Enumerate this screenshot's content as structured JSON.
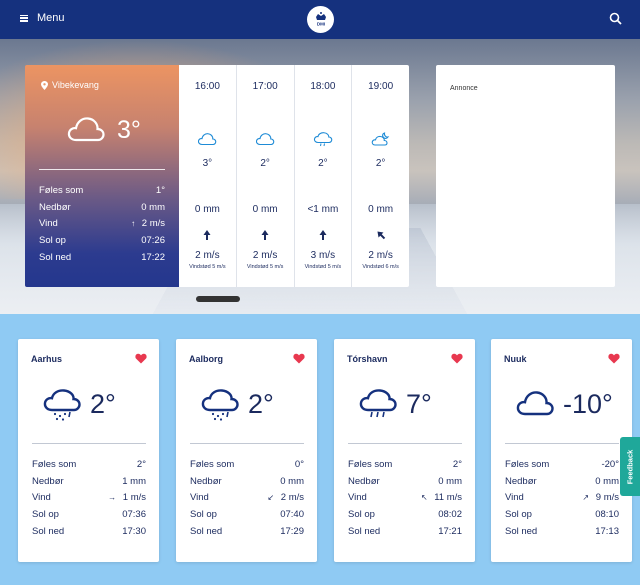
{
  "header": {
    "menu_label": "Menu",
    "logo_text": "DMI"
  },
  "current": {
    "location": "Vibekevang",
    "temp": "3°",
    "stats": [
      {
        "label": "Føles som",
        "value": "1°",
        "arrow": ""
      },
      {
        "label": "Nedbør",
        "value": "0 mm",
        "arrow": ""
      },
      {
        "label": "Vind",
        "value": "2 m/s",
        "arrow": "↑"
      },
      {
        "label": "Sol op",
        "value": "07:26",
        "arrow": ""
      },
      {
        "label": "Sol ned",
        "value": "17:22",
        "arrow": ""
      }
    ]
  },
  "hourly": [
    {
      "time": "16:00",
      "icon": "cloud-icon",
      "temp": "3°",
      "precip": "0 mm",
      "wind": "2 m/s",
      "gust": "Vindstød 5 m/s",
      "wind_dir_deg": 0
    },
    {
      "time": "17:00",
      "icon": "cloud-icon",
      "temp": "2°",
      "precip": "0 mm",
      "wind": "2 m/s",
      "gust": "Vindstød 5 m/s",
      "wind_dir_deg": 0
    },
    {
      "time": "18:00",
      "icon": "cloud-drizzle-icon",
      "temp": "2°",
      "precip": "<1 mm",
      "wind": "3 m/s",
      "gust": "Vindstød 5 m/s",
      "wind_dir_deg": 0
    },
    {
      "time": "19:00",
      "icon": "moon-cloud-icon",
      "temp": "2°",
      "precip": "0 mm",
      "wind": "2 m/s",
      "gust": "Vindstød 6 m/s",
      "wind_dir_deg": -45
    }
  ],
  "ad": {
    "label": "Annonce"
  },
  "cities": [
    {
      "name": "Aarhus",
      "icon": "cloud-snow-icon",
      "temp": "2°",
      "stats": [
        {
          "label": "Føles som",
          "value": "2°",
          "arrow": ""
        },
        {
          "label": "Nedbør",
          "value": "1 mm",
          "arrow": ""
        },
        {
          "label": "Vind",
          "value": "1 m/s",
          "arrow": "→"
        },
        {
          "label": "Sol op",
          "value": "07:36",
          "arrow": ""
        },
        {
          "label": "Sol ned",
          "value": "17:30",
          "arrow": ""
        }
      ]
    },
    {
      "name": "Aalborg",
      "icon": "cloud-snow-icon",
      "temp": "2°",
      "stats": [
        {
          "label": "Føles som",
          "value": "0°",
          "arrow": ""
        },
        {
          "label": "Nedbør",
          "value": "0 mm",
          "arrow": ""
        },
        {
          "label": "Vind",
          "value": "2 m/s",
          "arrow": "↙"
        },
        {
          "label": "Sol op",
          "value": "07:40",
          "arrow": ""
        },
        {
          "label": "Sol ned",
          "value": "17:29",
          "arrow": ""
        }
      ]
    },
    {
      "name": "Tórshavn",
      "icon": "cloud-rain-icon",
      "temp": "7°",
      "stats": [
        {
          "label": "Føles som",
          "value": "2°",
          "arrow": ""
        },
        {
          "label": "Nedbør",
          "value": "0 mm",
          "arrow": ""
        },
        {
          "label": "Vind",
          "value": "11 m/s",
          "arrow": "↖"
        },
        {
          "label": "Sol op",
          "value": "08:02",
          "arrow": ""
        },
        {
          "label": "Sol ned",
          "value": "17:21",
          "arrow": ""
        }
      ]
    },
    {
      "name": "Nuuk",
      "icon": "cloud-icon",
      "temp": "-10°",
      "stats": [
        {
          "label": "Føles som",
          "value": "-20°",
          "arrow": ""
        },
        {
          "label": "Nedbør",
          "value": "0 mm",
          "arrow": ""
        },
        {
          "label": "Vind",
          "value": "9 m/s",
          "arrow": "↗"
        },
        {
          "label": "Sol op",
          "value": "08:10",
          "arrow": ""
        },
        {
          "label": "Sol ned",
          "value": "17:13",
          "arrow": ""
        }
      ]
    }
  ],
  "feedback_label": "Feedback",
  "colors": {
    "navy": "#15317e",
    "sky": "#8fcaf3",
    "heart": "#e8384f",
    "teal": "#1fa89a",
    "icon_blue": "#1e8bd6"
  }
}
